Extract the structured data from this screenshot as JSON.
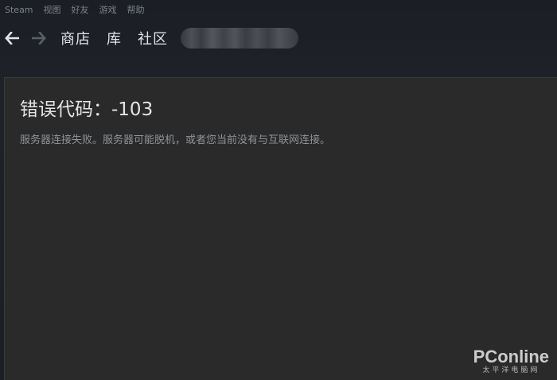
{
  "menubar": {
    "items": [
      {
        "label": "Steam"
      },
      {
        "label": "视图"
      },
      {
        "label": "好友"
      },
      {
        "label": "游戏"
      },
      {
        "label": "帮助"
      }
    ]
  },
  "navbar": {
    "links": [
      {
        "label": "商店"
      },
      {
        "label": "库"
      },
      {
        "label": "社区"
      }
    ],
    "back_icon": "arrow-left-icon",
    "forward_icon": "arrow-right-icon"
  },
  "error": {
    "title": "错误代码：-103",
    "message": "服务器连接失败。服务器可能脱机，或者您当前没有与互联网连接。"
  },
  "watermark": {
    "logo": "PConline",
    "subtitle": "太平洋电脑网"
  },
  "colors": {
    "background": "#1b1e24",
    "content_panel": "#2a2a2a",
    "title_text": "#e4e4e4",
    "message_text": "#8f9296",
    "nav_text": "#dfe3e6"
  }
}
